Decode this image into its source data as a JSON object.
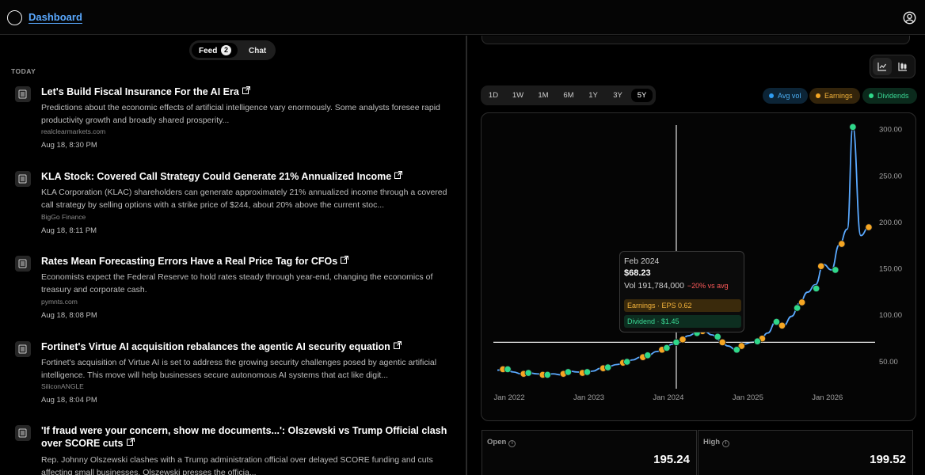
{
  "header": {
    "title": "Dashboard"
  },
  "feed_toggle": {
    "feed_label": "Feed",
    "feed_count": "2",
    "chat_label": "Chat"
  },
  "feed": {
    "section_label": "TODAY",
    "items": [
      {
        "title": "Let's Build Fiscal Insurance For the AI Era",
        "summary": "Predictions about the economic effects of artificial intelligence vary enormously. Some analysts foresee rapid productivity growth and broadly shared prosperity...",
        "source": "realclearmarkets.com",
        "time": "Aug 18, 8:30 PM"
      },
      {
        "title": "KLA Stock: Covered Call Strategy Could Generate 21% Annualized Income",
        "summary": "KLA Corporation (KLAC) shareholders can generate approximately 21% annualized income through a covered call strategy by selling options with a strike price of $244, about 20% above the current stoc...",
        "source": "BigGo Finance",
        "time": "Aug 18, 8:11 PM"
      },
      {
        "title": "Rates Mean Forecasting Errors Have a Real Price Tag for CFOs",
        "summary": "Economists expect the Federal Reserve to hold rates steady through year-end, changing the economics of treasury and corporate cash.",
        "source": "pymnts.com",
        "time": "Aug 18, 8:08 PM"
      },
      {
        "title": "Fortinet's Virtue AI acquisition rebalances the agentic AI security equation",
        "summary": "Fortinet's acquisition of Virtue AI is set to address the growing security challenges posed by agentic artificial intelligence. This move will help businesses secure autonomous AI systems that act like digit...",
        "source": "SiliconANGLE",
        "time": "Aug 18, 8:04 PM"
      },
      {
        "title": "'If fraud were your concern, show me documents...': Olszewski vs Trump Official clash over SCORE cuts",
        "summary": "Rep. Johnny Olszewski clashes with a Trump administration official over delayed SCORE funding and cuts affecting small businesses. Olszewski presses the officia...",
        "source": "",
        "time": ""
      }
    ]
  },
  "ranges": [
    "1D",
    "1W",
    "1M",
    "6M",
    "1Y",
    "3Y",
    "5Y"
  ],
  "active_range": "5Y",
  "legend": {
    "avg_vol": "Avg vol",
    "earnings": "Earnings",
    "dividends": "Dividends"
  },
  "colors": {
    "line": "#5aa9ff",
    "earnings": "#f5a623",
    "dividends": "#2fd88a",
    "avg_vol": "#2f9cf0",
    "negative": "#ff5a5a"
  },
  "tooltip": {
    "date": "Feb 2024",
    "price": "$68.23",
    "volume": "Vol 191,784,000",
    "volume_change": "−20% vs avg",
    "earnings": "Earnings · EPS 0.62",
    "dividend": "Dividend · $1.45"
  },
  "chart_data": {
    "type": "line",
    "x_ticks": [
      "Jan 2022",
      "Jan 2023",
      "Jan 2024",
      "Jan 2025",
      "Jan 2026"
    ],
    "y_ticks": [
      "300.00",
      "250.00",
      "200.00",
      "150.00",
      "100.00",
      "50.00"
    ],
    "ylim": [
      20,
      310
    ],
    "xlim": [
      2021.8,
      2026.6
    ],
    "grid": false,
    "series": [
      {
        "values": [
          [
            2021.85,
            40
          ],
          [
            2021.95,
            41
          ],
          [
            2022.05,
            38
          ],
          [
            2022.15,
            36
          ],
          [
            2022.25,
            37
          ],
          [
            2022.35,
            36
          ],
          [
            2022.45,
            35
          ],
          [
            2022.55,
            36
          ],
          [
            2022.65,
            35
          ],
          [
            2022.75,
            39
          ],
          [
            2022.85,
            38
          ],
          [
            2022.95,
            37
          ],
          [
            2023.05,
            39
          ],
          [
            2023.15,
            42
          ],
          [
            2023.25,
            44
          ],
          [
            2023.35,
            46
          ],
          [
            2023.45,
            48
          ],
          [
            2023.55,
            51
          ],
          [
            2023.65,
            54
          ],
          [
            2023.75,
            56
          ],
          [
            2023.85,
            60
          ],
          [
            2023.95,
            63
          ],
          [
            2024.05,
            68
          ],
          [
            2024.15,
            72
          ],
          [
            2024.25,
            77
          ],
          [
            2024.35,
            80
          ],
          [
            2024.45,
            82
          ],
          [
            2024.55,
            78
          ],
          [
            2024.65,
            72
          ],
          [
            2024.75,
            66
          ],
          [
            2024.85,
            62
          ],
          [
            2024.95,
            68
          ],
          [
            2025.05,
            70
          ],
          [
            2025.15,
            72
          ],
          [
            2025.25,
            80
          ],
          [
            2025.35,
            92
          ],
          [
            2025.45,
            88
          ],
          [
            2025.55,
            98
          ],
          [
            2025.65,
            112
          ],
          [
            2025.75,
            124
          ],
          [
            2025.85,
            132
          ],
          [
            2025.95,
            154
          ],
          [
            2026.05,
            148
          ],
          [
            2026.15,
            175
          ],
          [
            2026.25,
            192
          ],
          [
            2026.32,
            302
          ],
          [
            2026.42,
            185
          ],
          [
            2026.52,
            194
          ]
        ]
      }
    ],
    "earnings": [
      [
        2021.92,
        41
      ],
      [
        2022.18,
        36
      ],
      [
        2022.42,
        35
      ],
      [
        2022.68,
        36
      ],
      [
        2022.92,
        37
      ],
      [
        2023.18,
        42
      ],
      [
        2023.43,
        48
      ],
      [
        2023.68,
        54
      ],
      [
        2023.92,
        62
      ],
      [
        2024.18,
        73
      ],
      [
        2024.43,
        82
      ],
      [
        2024.68,
        70
      ],
      [
        2024.92,
        66
      ],
      [
        2025.18,
        74
      ],
      [
        2025.43,
        88
      ],
      [
        2025.68,
        113
      ],
      [
        2025.92,
        152
      ],
      [
        2026.18,
        176
      ],
      [
        2026.52,
        194
      ]
    ],
    "dividends": [
      [
        2021.98,
        41
      ],
      [
        2022.24,
        37
      ],
      [
        2022.48,
        35
      ],
      [
        2022.74,
        38
      ],
      [
        2022.98,
        38
      ],
      [
        2023.24,
        43
      ],
      [
        2023.48,
        49
      ],
      [
        2023.74,
        56
      ],
      [
        2023.98,
        64
      ],
      [
        2024.1,
        70
      ],
      [
        2024.36,
        80
      ],
      [
        2024.62,
        76
      ],
      [
        2024.86,
        62
      ],
      [
        2025.12,
        71
      ],
      [
        2025.36,
        92
      ],
      [
        2025.62,
        107
      ],
      [
        2025.86,
        128
      ],
      [
        2026.1,
        148
      ],
      [
        2026.32,
        302
      ]
    ],
    "crosshair": [
      2024.1,
      70
    ]
  },
  "stats": [
    {
      "label": "Open",
      "value": "195.24"
    },
    {
      "label": "High",
      "value": "199.52"
    }
  ]
}
